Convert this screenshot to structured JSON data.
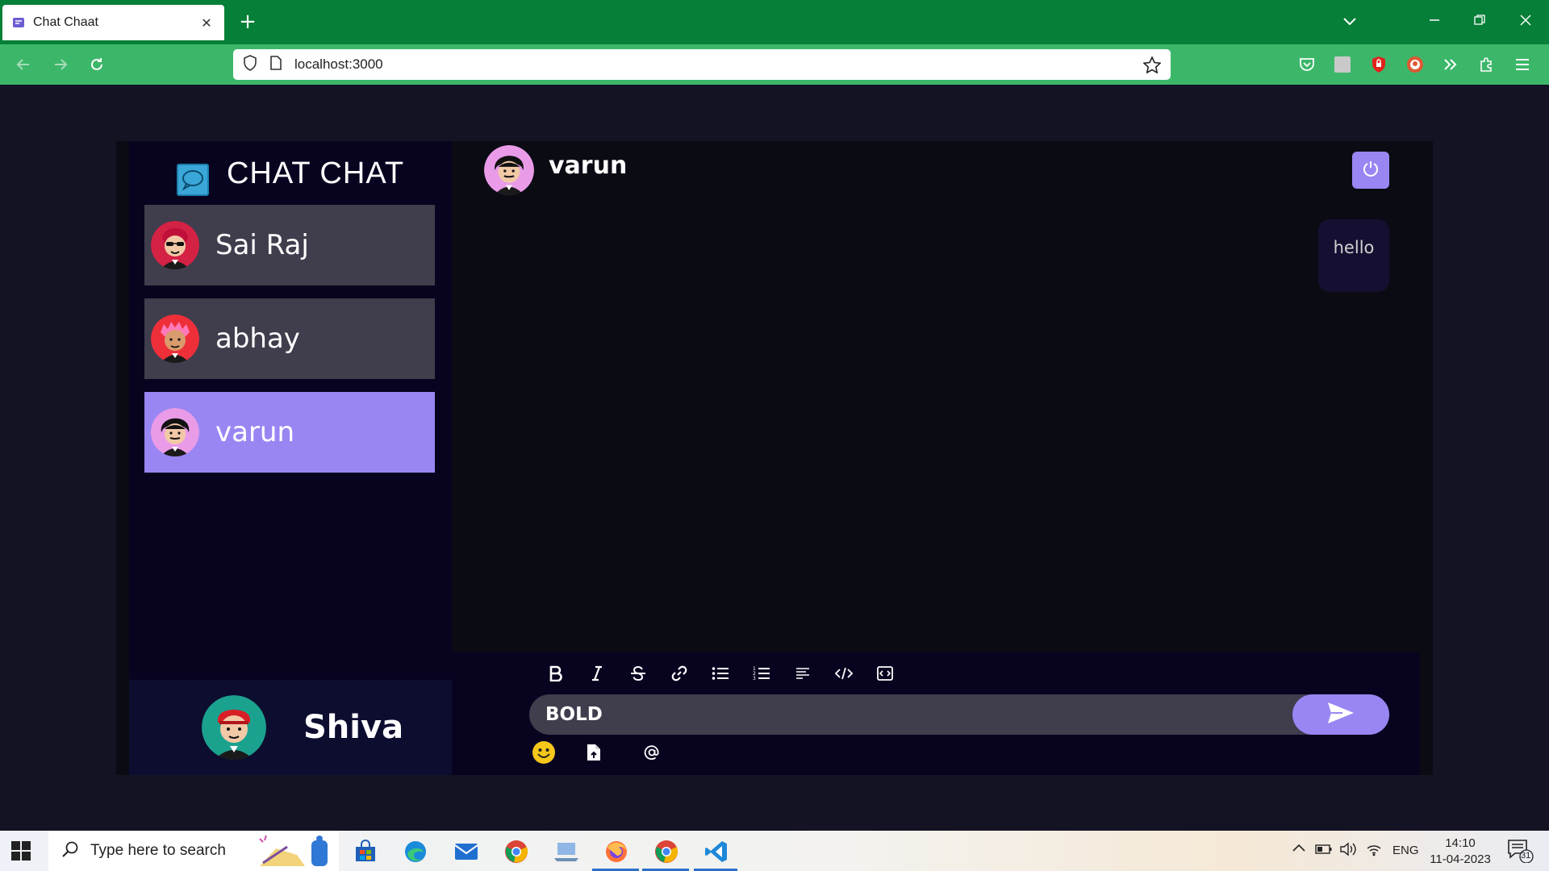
{
  "browser": {
    "tab_title": "Chat Chaat",
    "url": "localhost:3000",
    "tab_close": "✕",
    "new_tab": "+"
  },
  "app": {
    "brand": "CHAT CHAT",
    "contacts": [
      {
        "name": "Sai Raj",
        "selected": false
      },
      {
        "name": "abhay",
        "selected": false
      },
      {
        "name": "varun",
        "selected": true
      }
    ],
    "current_user": "Shiva",
    "chat": {
      "recipient": "varun",
      "messages": [
        {
          "direction": "sent",
          "text": "hello"
        }
      ],
      "input_value": "BOLD"
    },
    "colors": {
      "accent": "#9a86f3",
      "contact_bg": "#403d4d",
      "sidebar_bg": "#080420",
      "message_bg": "#150f31"
    }
  },
  "taskbar": {
    "search_placeholder": "Type here to search",
    "language": "ENG",
    "time": "14:10",
    "date": "11-04-2023",
    "notifications": "31"
  }
}
